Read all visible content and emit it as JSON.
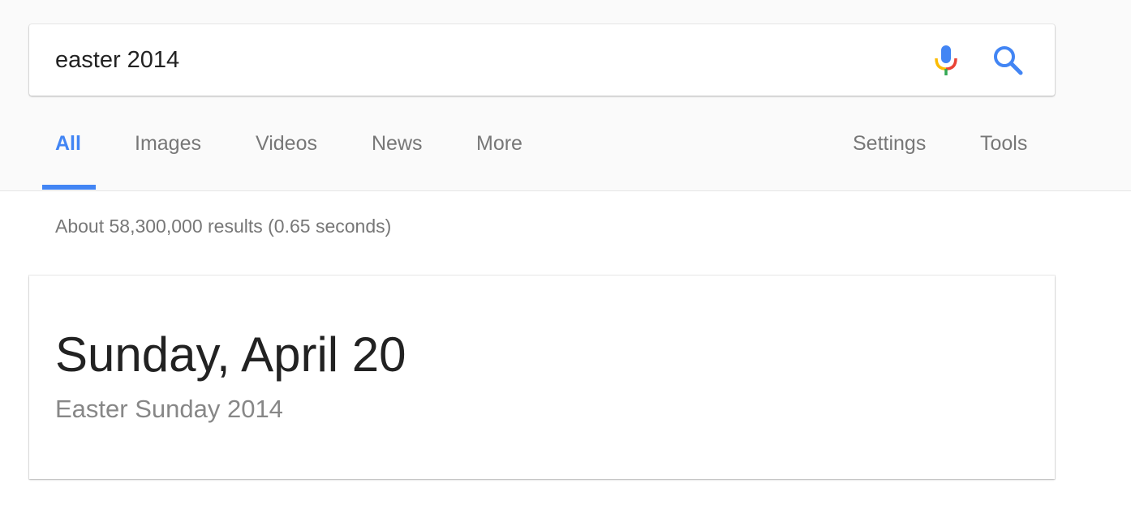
{
  "search": {
    "query": "easter 2014",
    "mic_icon": "microphone-icon",
    "search_icon": "search-icon",
    "colors": {
      "mic_blue": "#4285f4",
      "mic_red": "#ea4335",
      "mic_yellow": "#fbbc05",
      "mic_green": "#34a853",
      "search_blue": "#4285f4"
    }
  },
  "tabs": {
    "left": [
      {
        "label": "All",
        "active": true
      },
      {
        "label": "Images",
        "active": false
      },
      {
        "label": "Videos",
        "active": false
      },
      {
        "label": "News",
        "active": false
      },
      {
        "label": "More",
        "active": false
      }
    ],
    "right": [
      {
        "label": "Settings"
      },
      {
        "label": "Tools"
      }
    ],
    "accent_color": "#4285f4"
  },
  "results": {
    "stats": "About 58,300,000 results (0.65 seconds)"
  },
  "answer": {
    "title": "Sunday, April 20",
    "subtitle": "Easter Sunday 2014"
  }
}
